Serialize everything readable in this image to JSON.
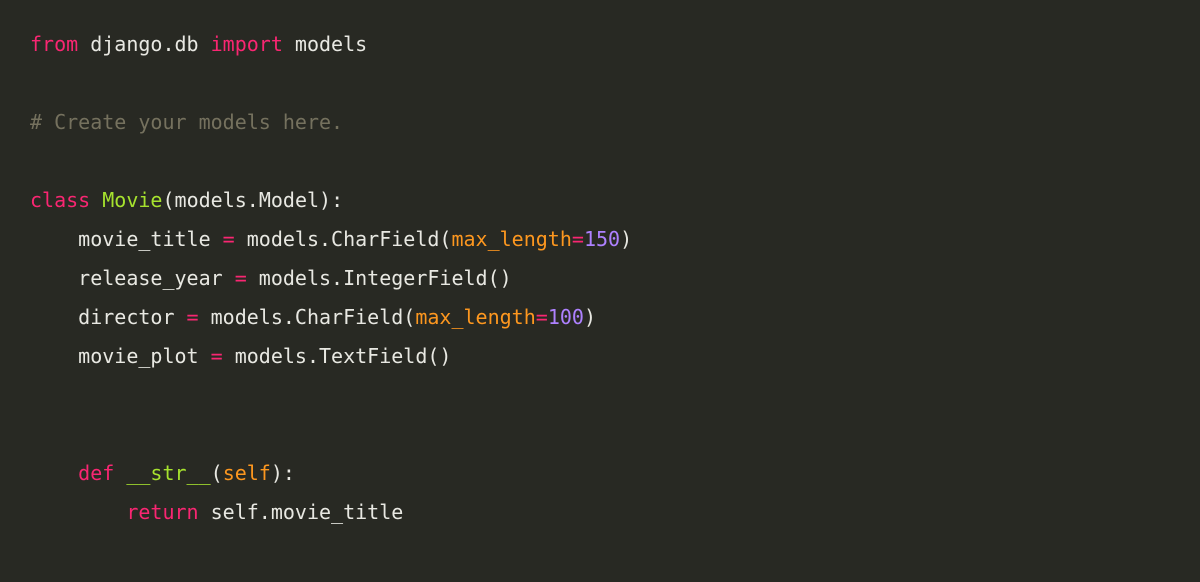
{
  "code": {
    "line1": {
      "kw1": "from",
      "mod1": " django.db ",
      "kw2": "import",
      "mod2": " models"
    },
    "line2_empty": " ",
    "line3": {
      "comment": "# Create your models here."
    },
    "line4_empty": " ",
    "line5": {
      "kw": "class",
      "space1": " ",
      "name": "Movie",
      "paren_open": "(",
      "base": "models.Model",
      "paren_close": ")",
      "colon": ":"
    },
    "line6": {
      "indent": "    ",
      "var": "movie_title ",
      "eq": "=",
      "call": " models.CharField(",
      "param": "max_length",
      "eq2": "=",
      "num": "150",
      "close": ")"
    },
    "line7": {
      "indent": "    ",
      "var": "release_year ",
      "eq": "=",
      "call": " models.IntegerField()"
    },
    "line8": {
      "indent": "    ",
      "var": "director ",
      "eq": "=",
      "call": " models.CharField(",
      "param": "max_length",
      "eq2": "=",
      "num": "100",
      "close": ")"
    },
    "line9": {
      "indent": "    ",
      "var": "movie_plot ",
      "eq": "=",
      "call": " models.TextField()"
    },
    "line10_empty": " ",
    "line11_empty": " ",
    "line12": {
      "indent": "    ",
      "kw": "def",
      "space": " ",
      "name": "__str__",
      "paren_open": "(",
      "param": "self",
      "paren_close": ")",
      "colon": ":"
    },
    "line13": {
      "indent": "        ",
      "kw": "return",
      "expr": " self.movie_title"
    }
  }
}
